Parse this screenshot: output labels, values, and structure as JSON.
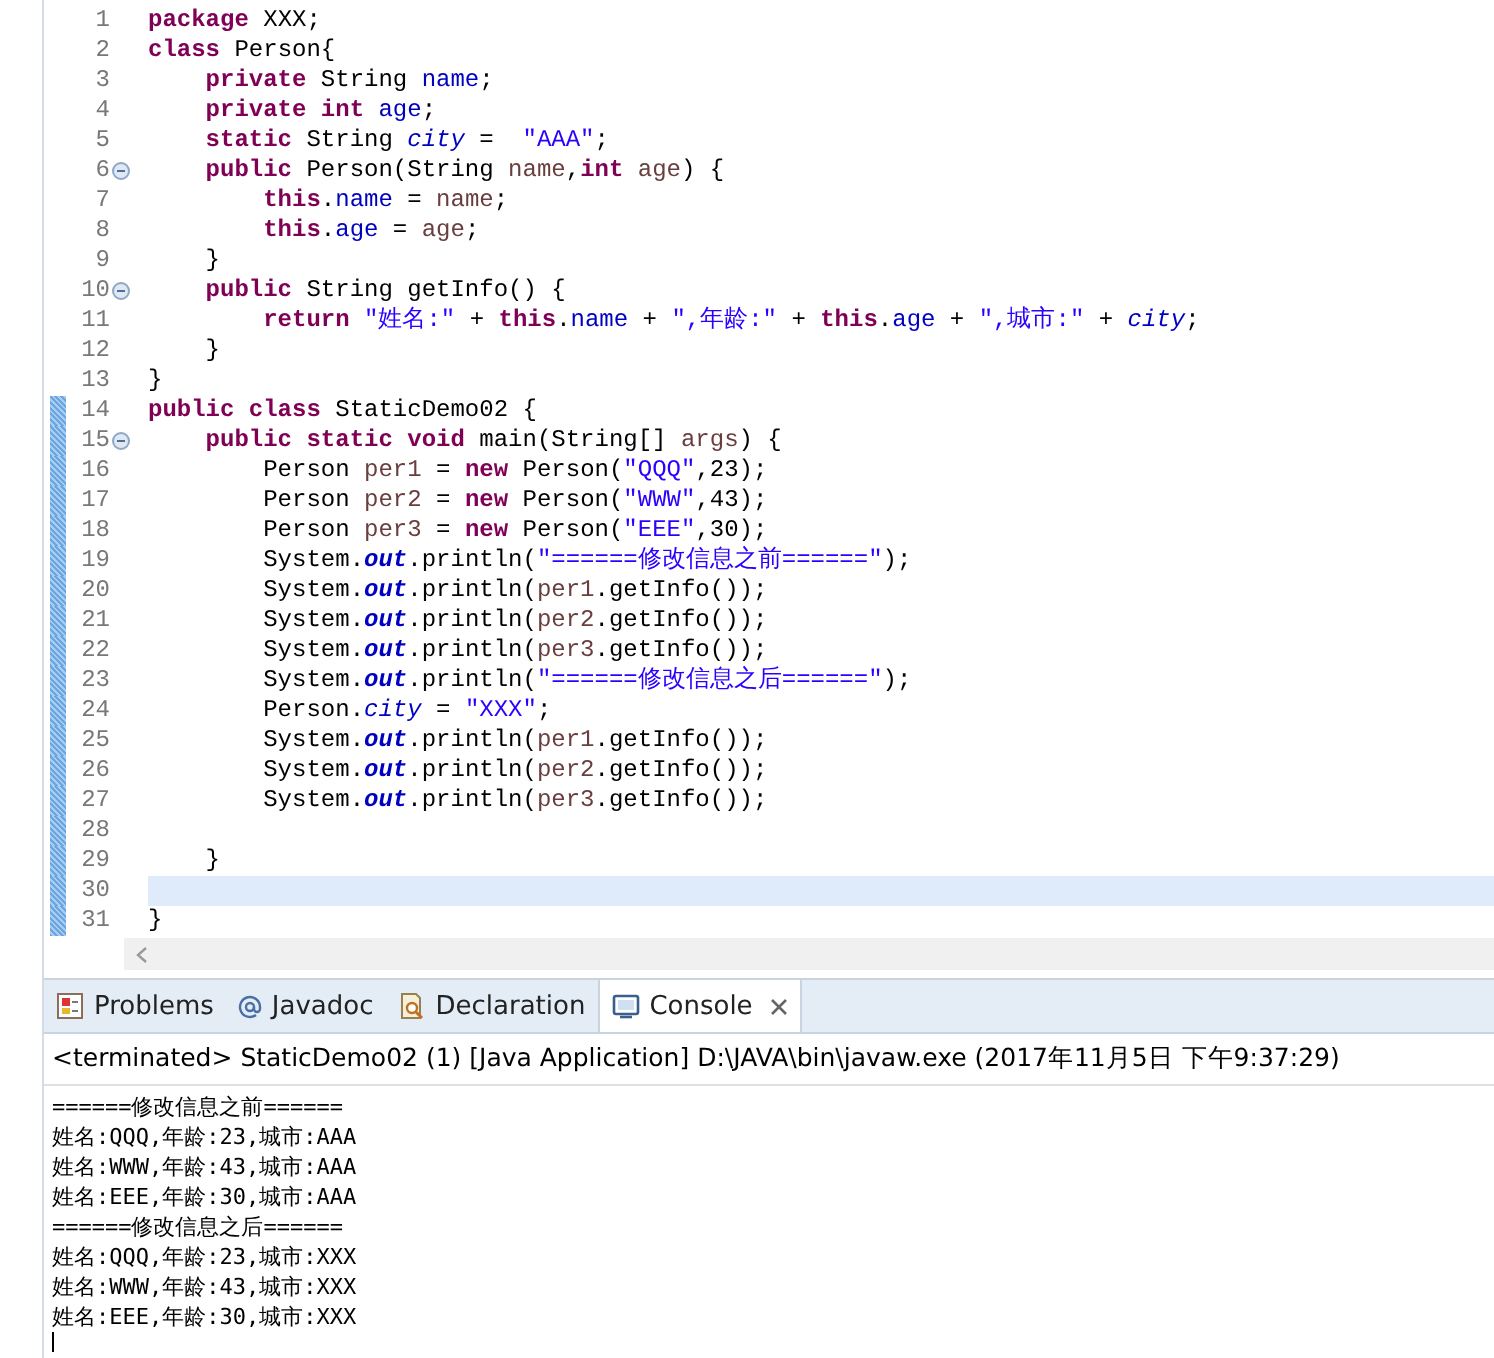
{
  "editor": {
    "lines": [
      {
        "number": "1",
        "fold": false,
        "changed": false,
        "current": false,
        "tokens": [
          {
            "kind": "kw",
            "text": "package"
          },
          {
            "kind": "p",
            "text": " XXX;"
          }
        ]
      },
      {
        "number": "2",
        "fold": false,
        "changed": false,
        "current": false,
        "tokens": [
          {
            "kind": "kw",
            "text": "class"
          },
          {
            "kind": "p",
            "text": " Person{"
          }
        ]
      },
      {
        "number": "3",
        "fold": false,
        "changed": false,
        "current": false,
        "tokens": [
          {
            "kind": "kw",
            "text": "    private"
          },
          {
            "kind": "p",
            "text": " String "
          },
          {
            "kind": "field",
            "text": "name"
          },
          {
            "kind": "p",
            "text": ";"
          }
        ]
      },
      {
        "number": "4",
        "fold": false,
        "changed": false,
        "current": false,
        "tokens": [
          {
            "kind": "kw",
            "text": "    private int"
          },
          {
            "kind": "field",
            "text": " age"
          },
          {
            "kind": "p",
            "text": ";"
          }
        ]
      },
      {
        "number": "5",
        "fold": false,
        "changed": false,
        "current": false,
        "tokens": [
          {
            "kind": "kw",
            "text": "    static"
          },
          {
            "kind": "p",
            "text": " String "
          },
          {
            "kind": "static",
            "text": "city"
          },
          {
            "kind": "p",
            "text": " =  "
          },
          {
            "kind": "str",
            "text": "\"AAA\""
          },
          {
            "kind": "p",
            "text": ";"
          }
        ]
      },
      {
        "number": "6",
        "fold": true,
        "changed": false,
        "current": false,
        "tokens": [
          {
            "kind": "kw",
            "text": "    public"
          },
          {
            "kind": "p",
            "text": " Person(String "
          },
          {
            "kind": "var",
            "text": "name"
          },
          {
            "kind": "p",
            "text": ","
          },
          {
            "kind": "kw",
            "text": "int"
          },
          {
            "kind": "var",
            "text": " age"
          },
          {
            "kind": "p",
            "text": ") {"
          }
        ]
      },
      {
        "number": "7",
        "fold": false,
        "changed": false,
        "current": false,
        "tokens": [
          {
            "kind": "kw",
            "text": "        this"
          },
          {
            "kind": "p",
            "text": "."
          },
          {
            "kind": "field",
            "text": "name"
          },
          {
            "kind": "p",
            "text": " = "
          },
          {
            "kind": "var",
            "text": "name"
          },
          {
            "kind": "p",
            "text": ";"
          }
        ]
      },
      {
        "number": "8",
        "fold": false,
        "changed": false,
        "current": false,
        "tokens": [
          {
            "kind": "kw",
            "text": "        this"
          },
          {
            "kind": "p",
            "text": "."
          },
          {
            "kind": "field",
            "text": "age"
          },
          {
            "kind": "p",
            "text": " = "
          },
          {
            "kind": "var",
            "text": "age"
          },
          {
            "kind": "p",
            "text": ";"
          }
        ]
      },
      {
        "number": "9",
        "fold": false,
        "changed": false,
        "current": false,
        "tokens": [
          {
            "kind": "p",
            "text": "    }"
          }
        ]
      },
      {
        "number": "10",
        "fold": true,
        "changed": false,
        "current": false,
        "tokens": [
          {
            "kind": "kw",
            "text": "    public"
          },
          {
            "kind": "p",
            "text": " String getInfo() {"
          }
        ]
      },
      {
        "number": "11",
        "fold": false,
        "changed": false,
        "current": false,
        "tokens": [
          {
            "kind": "kw",
            "text": "        return"
          },
          {
            "kind": "str",
            "text": " \"姓名:\""
          },
          {
            "kind": "p",
            "text": " + "
          },
          {
            "kind": "kw",
            "text": "this"
          },
          {
            "kind": "p",
            "text": "."
          },
          {
            "kind": "field",
            "text": "name"
          },
          {
            "kind": "p",
            "text": " + "
          },
          {
            "kind": "str",
            "text": "\",年龄:\""
          },
          {
            "kind": "p",
            "text": " + "
          },
          {
            "kind": "kw",
            "text": "this"
          },
          {
            "kind": "p",
            "text": "."
          },
          {
            "kind": "field",
            "text": "age"
          },
          {
            "kind": "p",
            "text": " + "
          },
          {
            "kind": "str",
            "text": "\",城市:\""
          },
          {
            "kind": "p",
            "text": " + "
          },
          {
            "kind": "static",
            "text": "city"
          },
          {
            "kind": "p",
            "text": ";"
          }
        ]
      },
      {
        "number": "12",
        "fold": false,
        "changed": false,
        "current": false,
        "tokens": [
          {
            "kind": "p",
            "text": "    }"
          }
        ]
      },
      {
        "number": "13",
        "fold": false,
        "changed": false,
        "current": false,
        "tokens": [
          {
            "kind": "p",
            "text": "}"
          }
        ]
      },
      {
        "number": "14",
        "fold": false,
        "changed": true,
        "current": false,
        "tokens": [
          {
            "kind": "kw",
            "text": "public class"
          },
          {
            "kind": "p",
            "text": " StaticDemo02 {"
          }
        ]
      },
      {
        "number": "15",
        "fold": true,
        "changed": true,
        "current": false,
        "tokens": [
          {
            "kind": "kw",
            "text": "    public static void"
          },
          {
            "kind": "p",
            "text": " main(String[] "
          },
          {
            "kind": "var",
            "text": "args"
          },
          {
            "kind": "p",
            "text": ") {"
          }
        ]
      },
      {
        "number": "16",
        "fold": false,
        "changed": true,
        "current": false,
        "tokens": [
          {
            "kind": "p",
            "text": "        Person "
          },
          {
            "kind": "var",
            "text": "per1"
          },
          {
            "kind": "p",
            "text": " = "
          },
          {
            "kind": "kw",
            "text": "new"
          },
          {
            "kind": "p",
            "text": " Person("
          },
          {
            "kind": "str",
            "text": "\"QQQ\""
          },
          {
            "kind": "p",
            "text": ",23);"
          }
        ]
      },
      {
        "number": "17",
        "fold": false,
        "changed": true,
        "current": false,
        "tokens": [
          {
            "kind": "p",
            "text": "        Person "
          },
          {
            "kind": "var",
            "text": "per2"
          },
          {
            "kind": "p",
            "text": " = "
          },
          {
            "kind": "kw",
            "text": "new"
          },
          {
            "kind": "p",
            "text": " Person("
          },
          {
            "kind": "str",
            "text": "\"WWW\""
          },
          {
            "kind": "p",
            "text": ",43);"
          }
        ]
      },
      {
        "number": "18",
        "fold": false,
        "changed": true,
        "current": false,
        "tokens": [
          {
            "kind": "p",
            "text": "        Person "
          },
          {
            "kind": "var",
            "text": "per3"
          },
          {
            "kind": "p",
            "text": " = "
          },
          {
            "kind": "kw",
            "text": "new"
          },
          {
            "kind": "p",
            "text": " Person("
          },
          {
            "kind": "str",
            "text": "\"EEE\""
          },
          {
            "kind": "p",
            "text": ",30);"
          }
        ]
      },
      {
        "number": "19",
        "fold": false,
        "changed": true,
        "current": false,
        "tokens": [
          {
            "kind": "p",
            "text": "        System."
          },
          {
            "kind": "sfinal",
            "text": "out"
          },
          {
            "kind": "p",
            "text": ".println("
          },
          {
            "kind": "str",
            "text": "\"======修改信息之前======\""
          },
          {
            "kind": "p",
            "text": ");"
          }
        ]
      },
      {
        "number": "20",
        "fold": false,
        "changed": true,
        "current": false,
        "tokens": [
          {
            "kind": "p",
            "text": "        System."
          },
          {
            "kind": "sfinal",
            "text": "out"
          },
          {
            "kind": "p",
            "text": ".println("
          },
          {
            "kind": "var",
            "text": "per1"
          },
          {
            "kind": "p",
            "text": ".getInfo());"
          }
        ]
      },
      {
        "number": "21",
        "fold": false,
        "changed": true,
        "current": false,
        "tokens": [
          {
            "kind": "p",
            "text": "        System."
          },
          {
            "kind": "sfinal",
            "text": "out"
          },
          {
            "kind": "p",
            "text": ".println("
          },
          {
            "kind": "var",
            "text": "per2"
          },
          {
            "kind": "p",
            "text": ".getInfo());"
          }
        ]
      },
      {
        "number": "22",
        "fold": false,
        "changed": true,
        "current": false,
        "tokens": [
          {
            "kind": "p",
            "text": "        System."
          },
          {
            "kind": "sfinal",
            "text": "out"
          },
          {
            "kind": "p",
            "text": ".println("
          },
          {
            "kind": "var",
            "text": "per3"
          },
          {
            "kind": "p",
            "text": ".getInfo());"
          }
        ]
      },
      {
        "number": "23",
        "fold": false,
        "changed": true,
        "current": false,
        "tokens": [
          {
            "kind": "p",
            "text": "        System."
          },
          {
            "kind": "sfinal",
            "text": "out"
          },
          {
            "kind": "p",
            "text": ".println("
          },
          {
            "kind": "str",
            "text": "\"======修改信息之后======\""
          },
          {
            "kind": "p",
            "text": ");"
          }
        ]
      },
      {
        "number": "24",
        "fold": false,
        "changed": true,
        "current": false,
        "tokens": [
          {
            "kind": "p",
            "text": "        Person."
          },
          {
            "kind": "static",
            "text": "city"
          },
          {
            "kind": "p",
            "text": " = "
          },
          {
            "kind": "str",
            "text": "\"XXX\""
          },
          {
            "kind": "p",
            "text": ";"
          }
        ]
      },
      {
        "number": "25",
        "fold": false,
        "changed": true,
        "current": false,
        "tokens": [
          {
            "kind": "p",
            "text": "        System."
          },
          {
            "kind": "sfinal",
            "text": "out"
          },
          {
            "kind": "p",
            "text": ".println("
          },
          {
            "kind": "var",
            "text": "per1"
          },
          {
            "kind": "p",
            "text": ".getInfo());"
          }
        ]
      },
      {
        "number": "26",
        "fold": false,
        "changed": true,
        "current": false,
        "tokens": [
          {
            "kind": "p",
            "text": "        System."
          },
          {
            "kind": "sfinal",
            "text": "out"
          },
          {
            "kind": "p",
            "text": ".println("
          },
          {
            "kind": "var",
            "text": "per2"
          },
          {
            "kind": "p",
            "text": ".getInfo());"
          }
        ]
      },
      {
        "number": "27",
        "fold": false,
        "changed": true,
        "current": false,
        "tokens": [
          {
            "kind": "p",
            "text": "        System."
          },
          {
            "kind": "sfinal",
            "text": "out"
          },
          {
            "kind": "p",
            "text": ".println("
          },
          {
            "kind": "var",
            "text": "per3"
          },
          {
            "kind": "p",
            "text": ".getInfo());"
          }
        ]
      },
      {
        "number": "28",
        "fold": false,
        "changed": true,
        "current": false
      },
      {
        "number": "29",
        "fold": false,
        "changed": true,
        "current": false,
        "tokens": [
          {
            "kind": "p",
            "text": "    }"
          }
        ]
      },
      {
        "number": "30",
        "fold": false,
        "changed": true,
        "current": true
      },
      {
        "number": "31",
        "fold": false,
        "changed": true,
        "current": false,
        "tokens": [
          {
            "kind": "p",
            "text": "}"
          }
        ]
      }
    ]
  },
  "views": {
    "tabs": [
      {
        "kind": "problems",
        "label": "Problems",
        "selected": false
      },
      {
        "kind": "javadoc",
        "label": "Javadoc",
        "selected": false
      },
      {
        "kind": "declaration",
        "label": "Declaration",
        "selected": false
      },
      {
        "kind": "console",
        "label": "Console",
        "selected": true
      }
    ]
  },
  "console": {
    "header": "<terminated> StaticDemo02 (1) [Java Application] D:\\JAVA\\bin\\javaw.exe (2017年11月5日 下午9:37:29)",
    "output": [
      "======修改信息之前======",
      "姓名:QQQ,年龄:23,城市:AAA",
      "姓名:WWW,年龄:43,城市:AAA",
      "姓名:EEE,年龄:30,城市:AAA",
      "======修改信息之后======",
      "姓名:QQQ,年龄:23,城市:XXX",
      "姓名:WWW,年龄:43,城市:XXX",
      "姓名:EEE,年龄:30,城市:XXX"
    ]
  }
}
